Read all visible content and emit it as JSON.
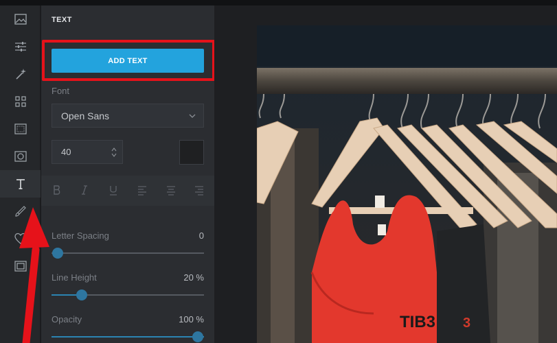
{
  "panel": {
    "title": "TEXT",
    "add_text_label": "ADD TEXT",
    "font_label": "Font",
    "font_value": "Open Sans",
    "size_value": "40",
    "color_swatch": "#1f2022",
    "letter_spacing": {
      "label": "Letter Spacing",
      "value": "0",
      "fraction": 0.0
    },
    "line_height": {
      "label": "Line Height",
      "value": "20 %",
      "fraction": 0.2
    },
    "opacity": {
      "label": "Opacity",
      "value": "100 %",
      "fraction": 1.0
    }
  },
  "rail": {
    "items": [
      "image-icon",
      "adjust-sliders-icon",
      "magic-wand-icon",
      "grid-icon",
      "frame-icon",
      "vignette-icon",
      "text-icon",
      "paint-icon",
      "heart-icon",
      "border-icon"
    ],
    "active": "text-icon"
  },
  "format_buttons": [
    "bold-icon",
    "italic-icon",
    "underline-icon",
    "align-left-icon",
    "align-center-icon",
    "align-right-icon"
  ],
  "colors": {
    "accent": "#23a3dd",
    "highlight": "#e6121a",
    "annotation_arrow": "#e6121a"
  },
  "canvas": {
    "photo_description_icon": "photo-of-clothes-on-hangers",
    "shirt_print": "TIB3"
  }
}
